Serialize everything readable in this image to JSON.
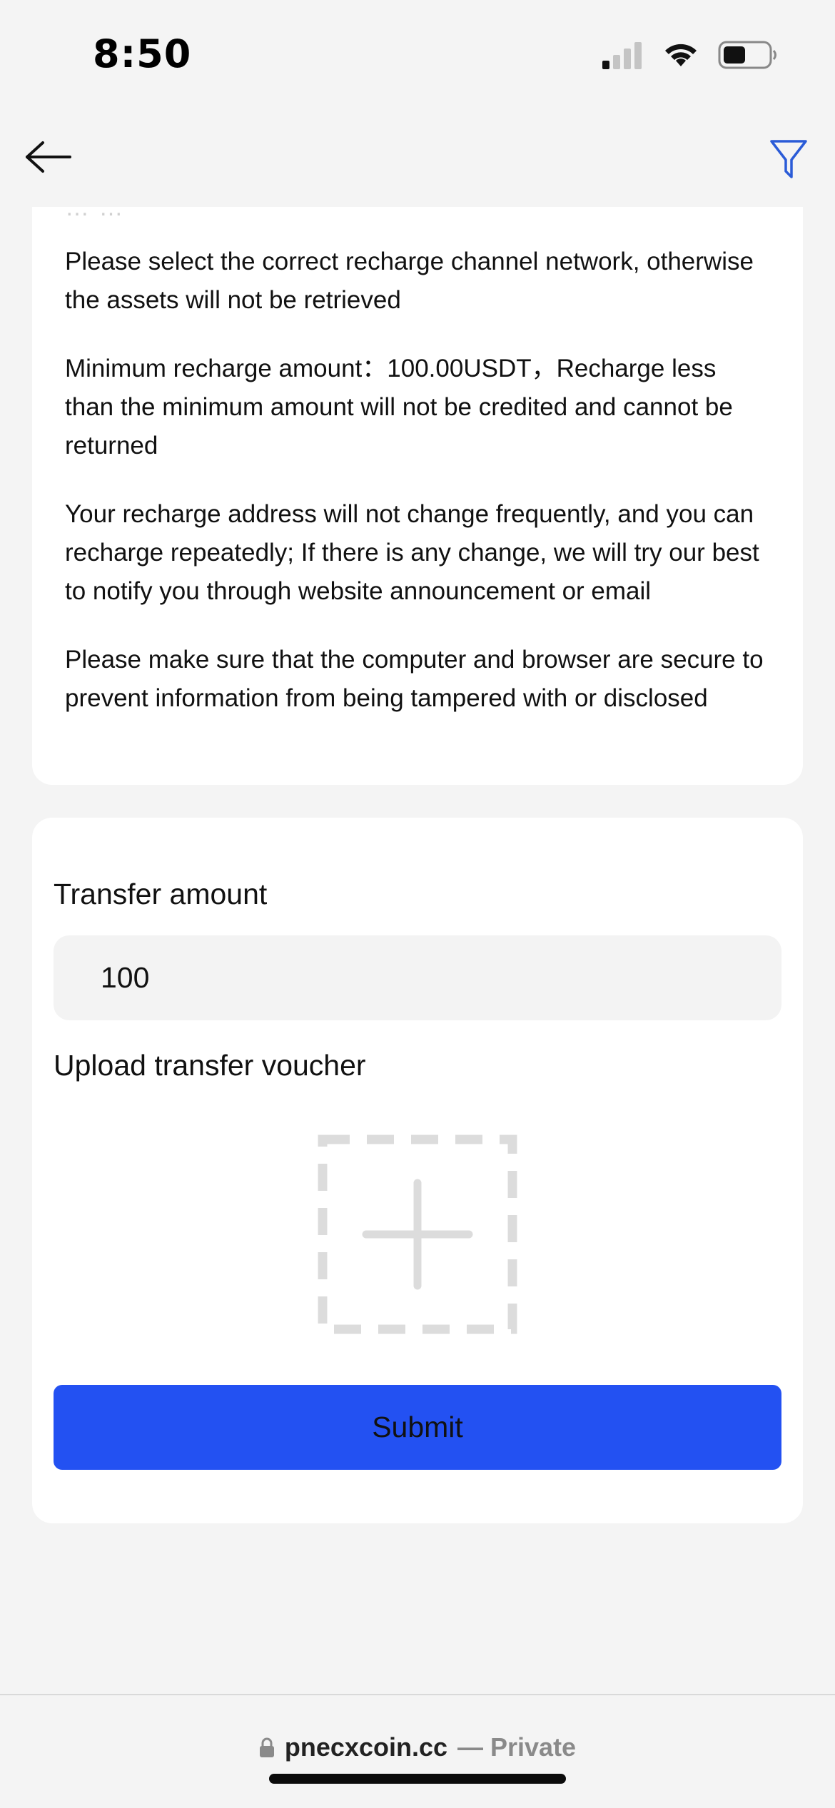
{
  "status_bar": {
    "time": "8:50"
  },
  "header": {
    "back_icon": "arrow-left-icon",
    "filter_icon": "funnel-icon",
    "accent_color": "#2a5bd7"
  },
  "notice": {
    "paragraphs": [
      "Please select the correct recharge channel network, otherwise the assets will not be retrieved",
      "Minimum recharge amount：100.00USDT，Recharge less than the minimum amount will not be credited and cannot be returned",
      "Your recharge address will not change frequently, and you can recharge repeatedly; If there is any change, we will try our best to notify you through website announcement or email",
      "Please make sure that the computer and browser are secure to prevent information from being tampered with or disclosed"
    ]
  },
  "form": {
    "amount_label": "Transfer amount",
    "amount_value": "100",
    "voucher_label": "Upload transfer voucher",
    "upload_icon": "plus-icon",
    "submit_label": "Submit",
    "submit_color": "#2351f2"
  },
  "browser": {
    "domain": "pnecxcoin.cc",
    "private_label": "— Private",
    "lock_icon": "lock-icon"
  }
}
